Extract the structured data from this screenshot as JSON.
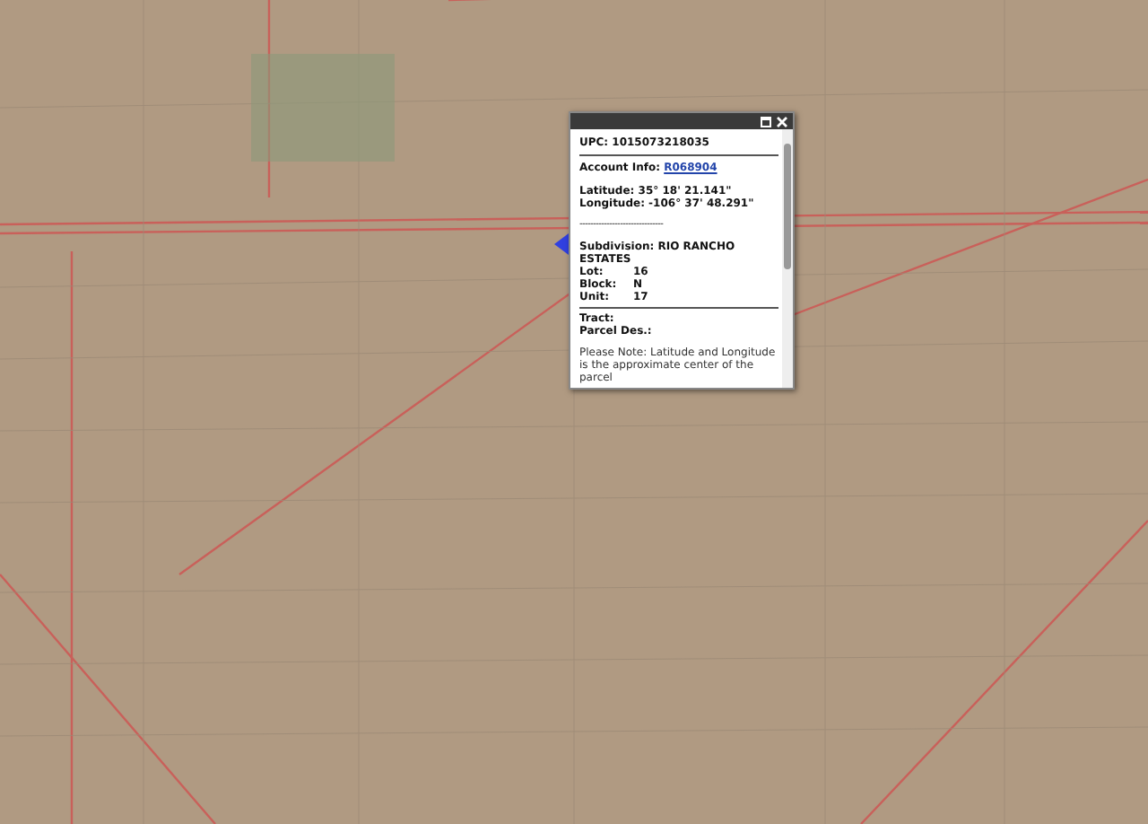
{
  "popup": {
    "upc": "UPC: 1015073218035",
    "account_label": "Account Info:",
    "account_link": "R068904",
    "latitude": "Latitude: 35° 18' 21.141\"",
    "longitude": "Longitude: -106° 37' 48.291\"",
    "separator": "-------------------------------",
    "subdivision": "Subdivision: RIO RANCHO ESTATES",
    "details": [
      {
        "label": "Lot:",
        "value": "16"
      },
      {
        "label": "Block:",
        "value": "N"
      },
      {
        "label": "Unit:",
        "value": "17"
      }
    ],
    "tract": "Tract:",
    "parcel": "Parcel Des.:",
    "note": "Please Note: Latitude and Longitude is the approximate center of the parcel"
  }
}
